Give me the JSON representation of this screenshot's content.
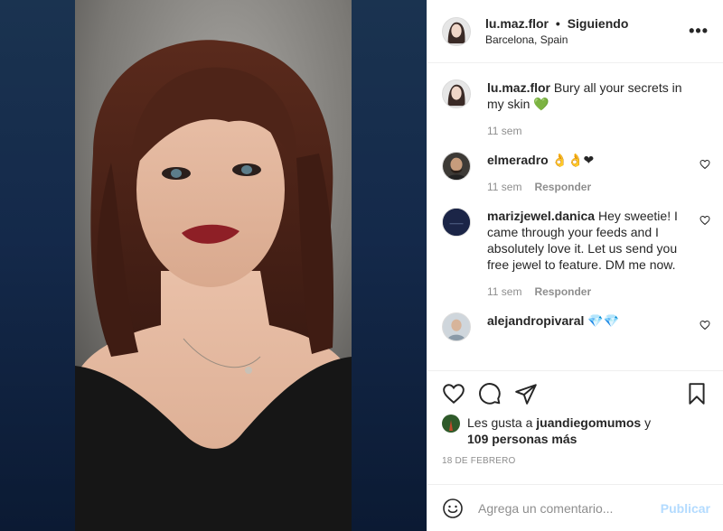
{
  "post": {
    "username": "lu.maz.flor",
    "separator": "•",
    "follow_status": "Siguiendo",
    "location": "Barcelona, Spain"
  },
  "caption": {
    "username": "lu.maz.flor",
    "text": "Bury all your secrets in my skin 💚",
    "time": "11 sem"
  },
  "comments": [
    {
      "username": "elmeradro",
      "text": "👌👌❤",
      "time": "11 sem",
      "reply": "Responder"
    },
    {
      "username": "marizjewel.danica",
      "text": "Hey sweetie! I came through your feeds and I absolutely love it. Let us send you free jewel to feature. DM me now.",
      "time": "11 sem",
      "reply": "Responder",
      "avatar_text": "MARIZ"
    },
    {
      "username": "alejandropivaral",
      "text": "💎💎"
    }
  ],
  "likes": {
    "prefix": "Les gusta a",
    "user": "juandiegomumos",
    "conj": "y",
    "others": "109 personas más"
  },
  "date": "18 DE FEBRERO",
  "add_comment": {
    "placeholder": "Agrega un comentario...",
    "publish": "Publicar"
  },
  "icons": {
    "more": "more-options-icon",
    "like": "heart-icon",
    "comment": "comment-icon",
    "share": "paper-plane-icon",
    "save": "bookmark-icon",
    "emoji": "emoji-icon"
  },
  "colors": {
    "publish_disabled": "#b3dbff",
    "secondary_text": "#8e8e8e",
    "border": "#efefef",
    "media_bg": "#14294a"
  }
}
